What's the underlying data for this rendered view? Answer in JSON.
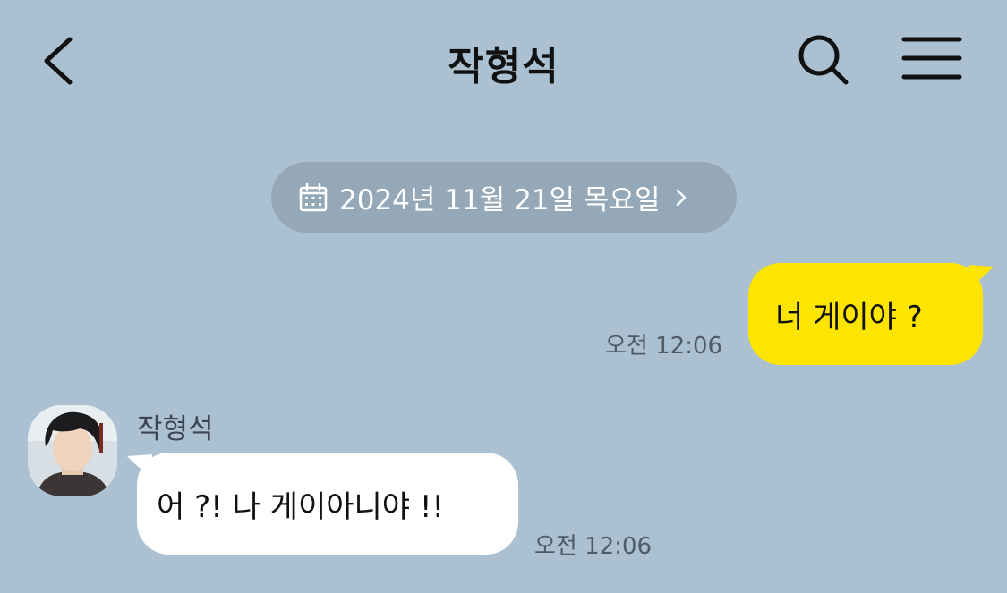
{
  "header": {
    "title": "작형석",
    "back_icon": "chevron-left-icon",
    "search_icon": "search-icon",
    "menu_icon": "hamburger-menu-icon"
  },
  "date_divider": {
    "icon": "calendar-icon",
    "text": "2024년 11월 21일 목요일",
    "chevron_icon": "chevron-right-icon"
  },
  "messages": [
    {
      "sender": "me",
      "text": "너 게이야 ?",
      "time": "오전 12:06",
      "bubble_color": "#fee500"
    },
    {
      "sender": "other",
      "sender_name": "작형석",
      "text": "어 ?! 나 게이아니야 !!",
      "time": "오전 12:06",
      "bubble_color": "#ffffff"
    }
  ],
  "colors": {
    "background": "#abc1d1",
    "date_pill": "#94a8b7",
    "my_bubble": "#fee500",
    "other_bubble": "#ffffff"
  }
}
